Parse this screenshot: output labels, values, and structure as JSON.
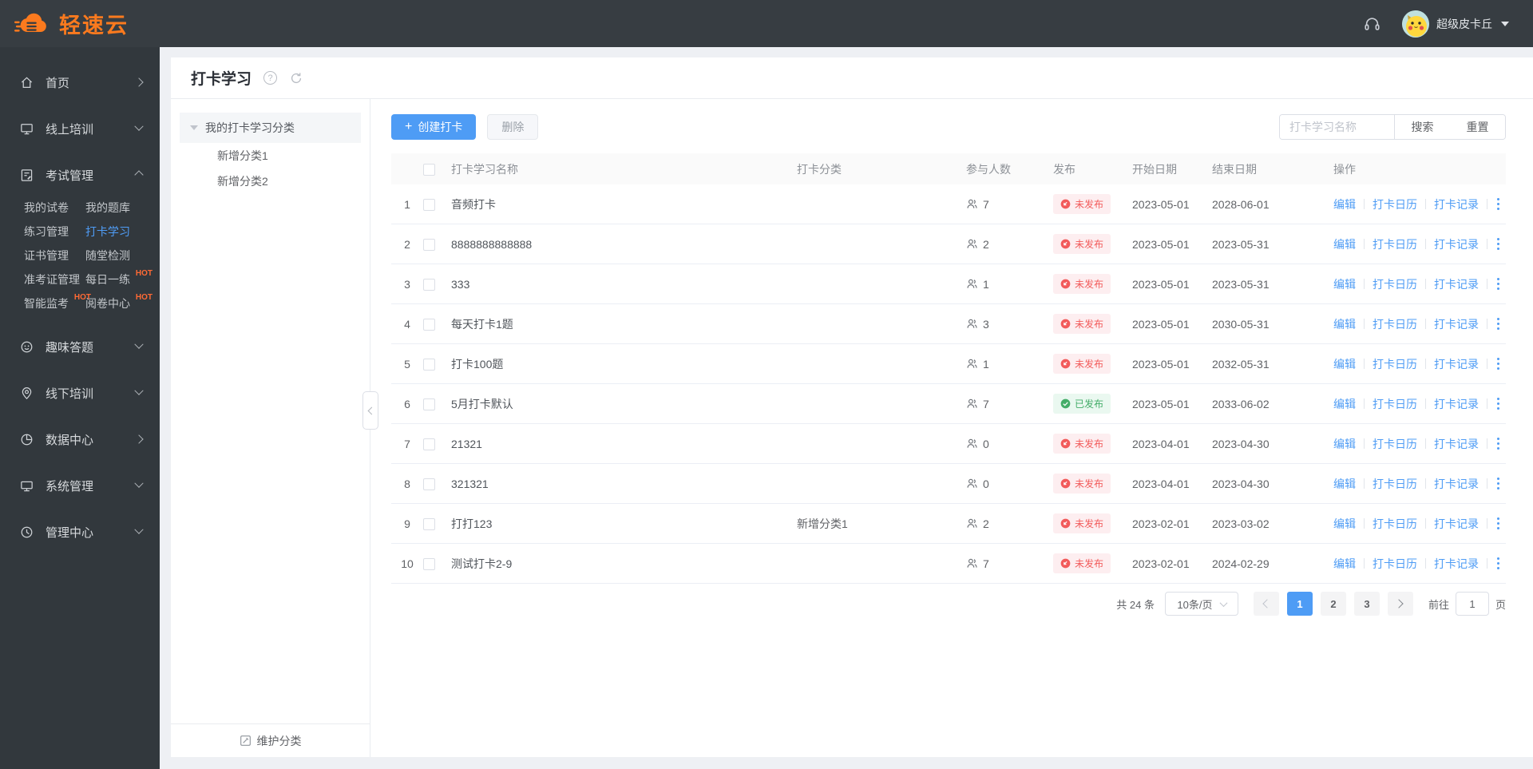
{
  "header": {
    "logo_text": "轻速云",
    "username": "超级皮卡丘"
  },
  "sidebar": {
    "hot_label": "HOT",
    "items_top": [
      {
        "label": "首页",
        "icon": "home-icon",
        "chevron": "right"
      },
      {
        "label": "线上培训",
        "icon": "monitor-icon",
        "chevron": "down"
      },
      {
        "label": "考试管理",
        "icon": "exam-icon",
        "chevron": "up"
      }
    ],
    "exam_submenu": [
      {
        "label": "我的试卷"
      },
      {
        "label": "我的题库"
      },
      {
        "label": "练习管理"
      },
      {
        "label": "打卡学习",
        "active": true
      },
      {
        "label": "证书管理"
      },
      {
        "label": "随堂检测"
      },
      {
        "label": "准考证管理"
      },
      {
        "label": "每日一练",
        "hot": true
      },
      {
        "label": "智能监考",
        "hot": true
      },
      {
        "label": "阅卷中心",
        "hot": true
      }
    ],
    "items_bottom": [
      {
        "label": "趣味答题",
        "icon": "fun-icon",
        "chevron": "down"
      },
      {
        "label": "线下培训",
        "icon": "location-icon",
        "chevron": "down"
      },
      {
        "label": "数据中心",
        "icon": "data-icon",
        "chevron": "right"
      },
      {
        "label": "系统管理",
        "icon": "system-icon",
        "chevron": "down"
      },
      {
        "label": "管理中心",
        "icon": "clock-icon",
        "chevron": "down"
      }
    ]
  },
  "page": {
    "title": "打卡学习"
  },
  "category_panel": {
    "root_label": "我的打卡学习分类",
    "children": [
      "新增分类1",
      "新增分类2"
    ],
    "footer_label": "维护分类"
  },
  "toolbar": {
    "create_plus": "+",
    "create_label": "创建打卡",
    "delete_label": "删除",
    "search_placeholder": "打卡学习名称",
    "search_label": "搜索",
    "reset_label": "重置"
  },
  "table": {
    "headers": {
      "name": "打卡学习名称",
      "category": "打卡分类",
      "participants": "参与人数",
      "publish": "发布",
      "start": "开始日期",
      "end": "结束日期",
      "ops": "操作"
    },
    "status_labels": {
      "published": "已发布",
      "unpublished": "未发布"
    },
    "action_labels": [
      "编辑",
      "打卡日历",
      "打卡记录"
    ],
    "rows": [
      {
        "index": 1,
        "name": "音频打卡",
        "category": "",
        "participants": 7,
        "published": false,
        "start": "2023-05-01",
        "end": "2028-06-01"
      },
      {
        "index": 2,
        "name": "8888888888888",
        "category": "",
        "participants": 2,
        "published": false,
        "start": "2023-05-01",
        "end": "2023-05-31"
      },
      {
        "index": 3,
        "name": "333",
        "category": "",
        "participants": 1,
        "published": false,
        "start": "2023-05-01",
        "end": "2023-05-31"
      },
      {
        "index": 4,
        "name": "每天打卡1题",
        "category": "",
        "participants": 3,
        "published": false,
        "start": "2023-05-01",
        "end": "2030-05-31"
      },
      {
        "index": 5,
        "name": "打卡100题",
        "category": "",
        "participants": 1,
        "published": false,
        "start": "2023-05-01",
        "end": "2032-05-31"
      },
      {
        "index": 6,
        "name": "5月打卡默认",
        "category": "",
        "participants": 7,
        "published": true,
        "start": "2023-05-01",
        "end": "2033-06-02"
      },
      {
        "index": 7,
        "name": "21321",
        "category": "",
        "participants": 0,
        "published": false,
        "start": "2023-04-01",
        "end": "2023-04-30"
      },
      {
        "index": 8,
        "name": "321321",
        "category": "",
        "participants": 0,
        "published": false,
        "start": "2023-04-01",
        "end": "2023-04-30"
      },
      {
        "index": 9,
        "name": "打打123",
        "category": "新增分类1",
        "participants": 2,
        "published": false,
        "start": "2023-02-01",
        "end": "2023-03-02"
      },
      {
        "index": 10,
        "name": "测试打卡2-9",
        "category": "",
        "participants": 7,
        "published": false,
        "start": "2023-02-01",
        "end": "2024-02-29"
      }
    ]
  },
  "pagination": {
    "total_text": "共 24 条",
    "page_size": "10条/页",
    "pages": [
      "1",
      "2",
      "3"
    ],
    "active_page": "1",
    "goto_prefix": "前往",
    "goto_value": "1",
    "goto_suffix": "页"
  },
  "colors": {
    "accent_blue": "#4e9cf5",
    "brand_orange": "#fb7a1e",
    "hot_orange": "#ff6a35",
    "status_red": "#f25b5b",
    "status_green": "#44ad68",
    "header_bg": "#373d42",
    "sidebar_bg": "#32383d"
  }
}
